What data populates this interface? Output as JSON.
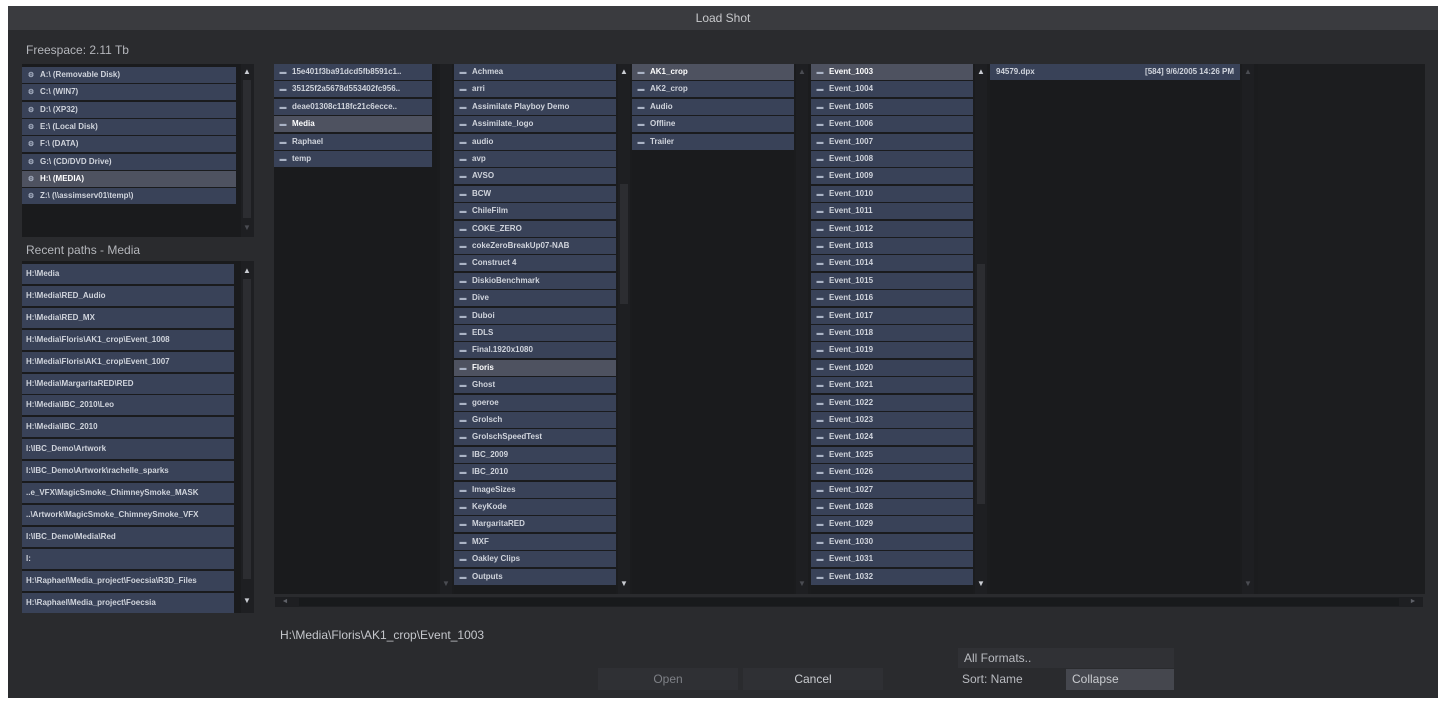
{
  "window": {
    "title": "Load Shot"
  },
  "freespace_label": "Freespace: 2.11 Tb",
  "drives": [
    {
      "label": "A:\\ (Removable Disk)"
    },
    {
      "label": "C:\\ (WIN7)"
    },
    {
      "label": "D:\\ (XP32)"
    },
    {
      "label": "E:\\ (Local Disk)"
    },
    {
      "label": "F:\\ (DATA)"
    },
    {
      "label": "G:\\ (CD/DVD Drive)"
    },
    {
      "label": "H:\\ (MEDIA)",
      "selected": true
    },
    {
      "label": "Z:\\ (\\\\assimserv01\\temp\\)"
    }
  ],
  "recent_label": "Recent paths - Media",
  "recent_paths": [
    "H:\\Media",
    "H:\\Media\\RED_Audio",
    "H:\\Media\\RED_MX",
    "H:\\Media\\Floris\\AK1_crop\\Event_1008",
    "H:\\Media\\Floris\\AK1_crop\\Event_1007",
    "H:\\Media\\MargaritaRED\\RED",
    "H:\\Media\\IBC_2010\\Leo",
    "H:\\Media\\IBC_2010",
    "I:\\IBC_Demo\\Artwork",
    "I:\\IBC_Demo\\Artwork\\rachelle_sparks",
    "..e_VFX\\MagicSmoke_ChimneySmoke_MASK",
    "..\\Artwork\\MagicSmoke_ChimneySmoke_VFX",
    "I:\\IBC_Demo\\Media\\Red",
    "I:",
    "H:\\Raphael\\Media_project\\Foecsia\\R3D_Files",
    "H:\\Raphael\\Media_project\\Foecsia"
  ],
  "columns": {
    "col1": [
      {
        "label": "15e401f3ba91dcd5fb8591c1.."
      },
      {
        "label": "35125f2a5678d553402fc956.."
      },
      {
        "label": "deae01308c118fc21c6ecce.."
      },
      {
        "label": "Media",
        "selected": true
      },
      {
        "label": "Raphael"
      },
      {
        "label": "temp"
      }
    ],
    "col2": [
      {
        "label": "Achmea"
      },
      {
        "label": "arri"
      },
      {
        "label": "Assimilate Playboy Demo"
      },
      {
        "label": "Assimilate_logo"
      },
      {
        "label": "audio"
      },
      {
        "label": "avp"
      },
      {
        "label": "AVSO"
      },
      {
        "label": "BCW"
      },
      {
        "label": "ChileFilm"
      },
      {
        "label": "COKE_ZERO"
      },
      {
        "label": "cokeZeroBreakUp07-NAB"
      },
      {
        "label": "Construct 4"
      },
      {
        "label": "DiskioBenchmark"
      },
      {
        "label": "Dive"
      },
      {
        "label": "Duboi"
      },
      {
        "label": "EDLS"
      },
      {
        "label": "Final.1920x1080"
      },
      {
        "label": "Floris",
        "selected": true
      },
      {
        "label": "Ghost"
      },
      {
        "label": "goeroe"
      },
      {
        "label": "Grolsch"
      },
      {
        "label": "GrolschSpeedTest"
      },
      {
        "label": "IBC_2009"
      },
      {
        "label": "IBC_2010"
      },
      {
        "label": "ImageSizes"
      },
      {
        "label": "KeyKode"
      },
      {
        "label": "MargaritaRED"
      },
      {
        "label": "MXF"
      },
      {
        "label": "Oakley Clips"
      },
      {
        "label": "Outputs"
      }
    ],
    "col3": [
      {
        "label": "AK1_crop",
        "selected": true
      },
      {
        "label": "AK2_crop"
      },
      {
        "label": "Audio"
      },
      {
        "label": "Offline"
      },
      {
        "label": "Trailer"
      }
    ],
    "col4": [
      {
        "label": "Event_1003",
        "selected": true
      },
      {
        "label": "Event_1004"
      },
      {
        "label": "Event_1005"
      },
      {
        "label": "Event_1006"
      },
      {
        "label": "Event_1007"
      },
      {
        "label": "Event_1008"
      },
      {
        "label": "Event_1009"
      },
      {
        "label": "Event_1010"
      },
      {
        "label": "Event_1011"
      },
      {
        "label": "Event_1012"
      },
      {
        "label": "Event_1013"
      },
      {
        "label": "Event_1014"
      },
      {
        "label": "Event_1015"
      },
      {
        "label": "Event_1016"
      },
      {
        "label": "Event_1017"
      },
      {
        "label": "Event_1018"
      },
      {
        "label": "Event_1019"
      },
      {
        "label": "Event_1020"
      },
      {
        "label": "Event_1021"
      },
      {
        "label": "Event_1022"
      },
      {
        "label": "Event_1023"
      },
      {
        "label": "Event_1024"
      },
      {
        "label": "Event_1025"
      },
      {
        "label": "Event_1026"
      },
      {
        "label": "Event_1027"
      },
      {
        "label": "Event_1028"
      },
      {
        "label": "Event_1029"
      },
      {
        "label": "Event_1030"
      },
      {
        "label": "Event_1031"
      },
      {
        "label": "Event_1032"
      }
    ]
  },
  "files": [
    {
      "name": "94579.dpx",
      "info": "[584] 9/6/2005 14:26 PM"
    }
  ],
  "current_path": "H:\\Media\\Floris\\AK1_crop\\Event_1003",
  "buttons": {
    "open": "Open",
    "cancel": "Cancel"
  },
  "format_selector": "All Formats..",
  "sort_label": "Sort: Name",
  "collapse_label": "Collapse",
  "icons": {
    "drive": "drive-icon",
    "folder": "folder-icon",
    "scroll_up": "scroll-up-arrow",
    "scroll_down": "scroll-down-arrow"
  }
}
